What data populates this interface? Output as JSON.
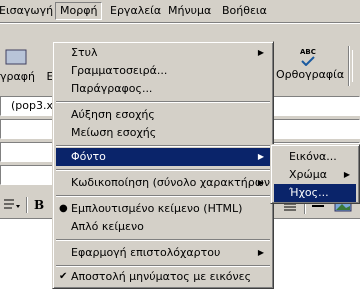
{
  "menubar": {
    "items": [
      "Εισαγωγή",
      "Μορφή",
      "Εργαλεία",
      "Μήνυμα",
      "Βοήθεια"
    ]
  },
  "toolbar": {
    "left_fragment": "γραφή",
    "left_fragment2": "Ε",
    "spell_label": "Ορθογραφία",
    "spell_icon_text": "ABC",
    "field_text": "(pop3.x-"
  },
  "format_menu": {
    "items": [
      {
        "label": "Στυλ",
        "submenu": true
      },
      {
        "label": "Γραμματοσειρά..."
      },
      {
        "label": "Παράγραφος..."
      },
      {
        "label": "Αύξηση εσοχής"
      },
      {
        "label": "Μείωση εσοχής"
      },
      {
        "label": "Φόντο",
        "submenu": true,
        "highlighted": true
      },
      {
        "label": "Κωδικοποίηση (σύνολο χαρακτήρων)",
        "submenu": true
      },
      {
        "label": "Εμπλουτισμένο κείμενο (HTML)",
        "mark": "bullet"
      },
      {
        "label": "Απλό κείμενο"
      },
      {
        "label": "Εφαρμογή επιστολόχαρτου",
        "submenu": true
      },
      {
        "label": "Αποστολή μηνύματος με εικόνες",
        "mark": "check"
      }
    ]
  },
  "background_submenu": {
    "items": [
      {
        "label": "Εικόνα..."
      },
      {
        "label": "Χρώμα",
        "submenu": true
      },
      {
        "label": "Ήχος...",
        "highlighted": true
      }
    ]
  }
}
